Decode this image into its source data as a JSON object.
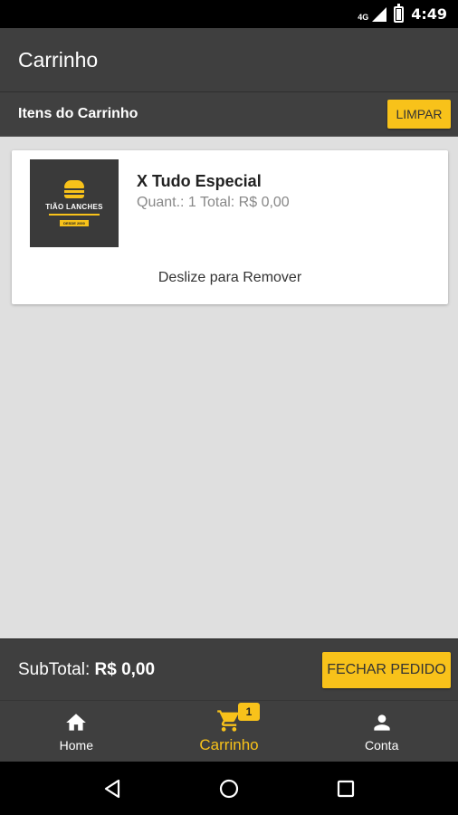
{
  "status_bar": {
    "network": "4G",
    "time": "4:49"
  },
  "app_bar": {
    "title": "Carrinho"
  },
  "cart_header": {
    "title": "Itens do Carrinho",
    "clear_label": "LIMPAR"
  },
  "cart_items": [
    {
      "name": "X Tudo Especial",
      "details": "Quant.: 1 Total: R$ 0,00",
      "swipe_hint": "Deslize para Remover",
      "logo": {
        "name": "TIÃO LANCHES",
        "badge": "DESDE 2000"
      }
    }
  ],
  "summary": {
    "subtotal_label": "SubTotal:",
    "subtotal_value": "R$ 0,00",
    "finish_label": "FECHAR PEDIDO"
  },
  "bottom_nav": [
    {
      "label": "Home",
      "icon": "home-icon"
    },
    {
      "label": "Carrinho",
      "icon": "cart-icon",
      "badge": "1",
      "active": true
    },
    {
      "label": "Conta",
      "icon": "person-icon"
    }
  ],
  "colors": {
    "accent": "#f8c21a",
    "bar": "#3f3f3f",
    "background": "#dfdfdf"
  }
}
